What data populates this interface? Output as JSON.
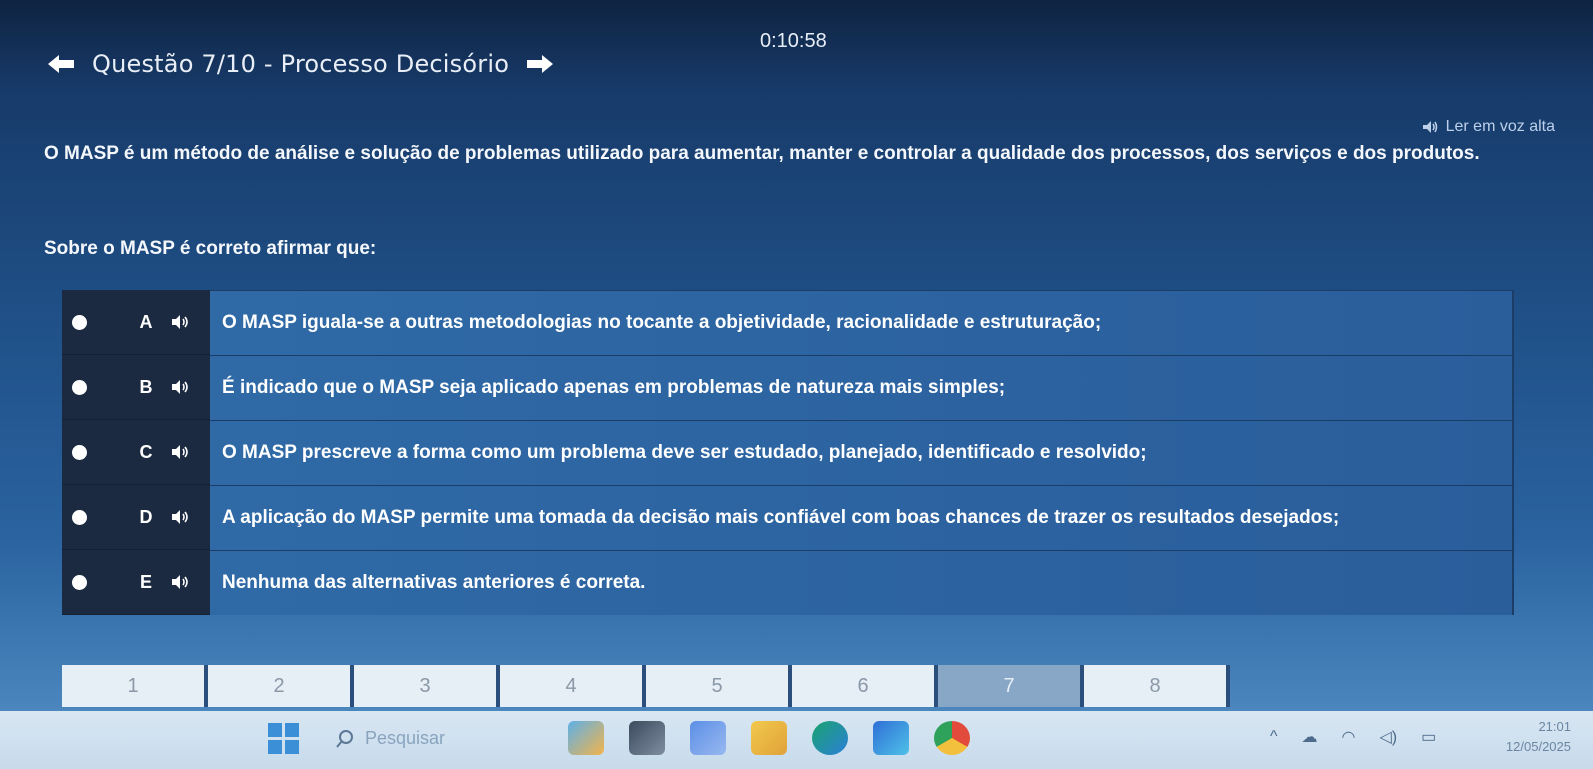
{
  "timer": "0:10:58",
  "header": {
    "title": "Questão 7/10 - Processo Decisório"
  },
  "tts": {
    "label": "Ler em voz alta"
  },
  "question": {
    "statement": "O MASP é um método de análise e solução de problemas utilizado para aumentar, manter e controlar a qualidade dos processos, dos serviços e dos produtos.",
    "prompt": "Sobre o MASP é correto afirmar que:"
  },
  "options": [
    {
      "letter": "A",
      "text": "O MASP iguala-se a outras metodologias no tocante a objetividade, racionalidade e estruturação;"
    },
    {
      "letter": "B",
      "text": "É indicado que o MASP seja aplicado apenas em problemas de natureza mais simples;"
    },
    {
      "letter": "C",
      "text": "O MASP prescreve a forma como um problema deve ser estudado, planejado, identificado e resolvido;"
    },
    {
      "letter": "D",
      "text": "A aplicação do MASP permite uma tomada da decisão mais confiável com boas chances de trazer os resultados desejados;"
    },
    {
      "letter": "E",
      "text": "Nenhuma das alternativas anteriores é correta."
    }
  ],
  "pager": {
    "pages": [
      "1",
      "2",
      "3",
      "4",
      "5",
      "6",
      "7",
      "8"
    ],
    "active": "7"
  },
  "taskbar": {
    "search_placeholder": "Pesquisar",
    "time": "21:01",
    "date": "12/05/2025"
  },
  "colors": {
    "option_bg": "#2f6aa6",
    "letter_bg": "#1b2a40",
    "pager_bg": "#e6eef6",
    "pager_active": "#88a6c6"
  }
}
